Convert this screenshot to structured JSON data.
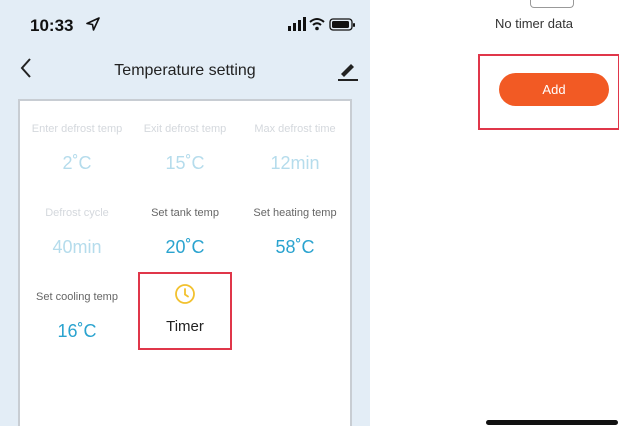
{
  "status_bar": {
    "time": "10:33"
  },
  "navbar": {
    "title": "Temperature setting"
  },
  "settings": [
    {
      "label": "Enter defrost temp",
      "value": "2˚C"
    },
    {
      "label": "Exit defrost temp",
      "value": "15˚C"
    },
    {
      "label": "Max defrost time",
      "value": "12min"
    },
    {
      "label": "Defrost cycle",
      "value": "40min"
    },
    {
      "label": "Set tank temp",
      "value": "20˚C"
    },
    {
      "label": "Set heating temp",
      "value": "58˚C"
    },
    {
      "label": "Set cooling temp",
      "value": "16˚C"
    }
  ],
  "timer": {
    "label": "Timer"
  },
  "timer_page": {
    "empty_text": "No timer data",
    "add_label": "Add"
  },
  "colors": {
    "accent": "#2aa3cf",
    "add_button": "#f25a24",
    "highlight": "#e0364a",
    "clock_icon": "#f2c12e"
  }
}
